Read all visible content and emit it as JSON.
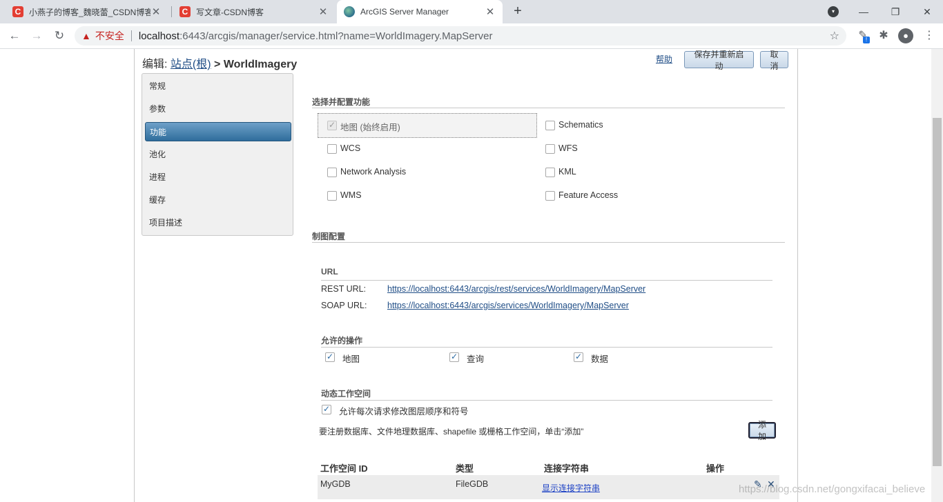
{
  "browser": {
    "tabs": [
      {
        "title": "小燕子的博客_魏晓蕾_CSDN博客",
        "favicon": "csdn-icon",
        "favicon_glyph": "C"
      },
      {
        "title": "写文章-CSDN博客",
        "favicon": "csdn-icon",
        "favicon_glyph": "C"
      },
      {
        "title": "ArcGIS Server Manager",
        "favicon": "globe-icon",
        "favicon_glyph": ""
      }
    ],
    "close_glyph": "✕",
    "new_tab_glyph": "+",
    "controls": {
      "minimize": "—",
      "restore": "❐",
      "close": "✕"
    },
    "profile_glyph": "▾",
    "nav": {
      "back": "←",
      "forward": "→",
      "reload": "↻"
    },
    "security_warning_glyph": "▲",
    "security_label": "不安全",
    "url_host": "localhost",
    "url_rest": ":6443/arcgis/manager/service.html?name=WorldImagery.MapServer",
    "bookmark_glyph": "☆",
    "extension_glyph": "✎",
    "extension_badge": "!",
    "puzzle_glyph": "✱",
    "account_glyph": "●",
    "menu_glyph": "⋮"
  },
  "page": {
    "heading_prefix": "编辑: ",
    "breadcrumb_root": "站点(根)",
    "breadcrumb_sep": " > ",
    "current_service": "WorldImagery",
    "help_label": "帮助",
    "save_restart_label": "保存并重新启动",
    "cancel_label": "取消"
  },
  "sidebar": {
    "items": [
      {
        "label": "常规"
      },
      {
        "label": "参数"
      },
      {
        "label": "功能",
        "selected": true
      },
      {
        "label": "池化"
      },
      {
        "label": "进程"
      },
      {
        "label": "缓存"
      },
      {
        "label": "项目描述"
      }
    ]
  },
  "capabilities": {
    "section_title": "选择并配置功能",
    "items": [
      {
        "label": "地图 (始终启用)",
        "checked": true,
        "disabled": true
      },
      {
        "label": "Schematics",
        "checked": false
      },
      {
        "label": "WCS",
        "checked": false
      },
      {
        "label": "WFS",
        "checked": false
      },
      {
        "label": "Network Analysis",
        "checked": false
      },
      {
        "label": "KML",
        "checked": false
      },
      {
        "label": "WMS",
        "checked": false
      },
      {
        "label": "Feature Access",
        "checked": false
      }
    ]
  },
  "mapping": {
    "section_title": "制图配置",
    "url_title": "URL",
    "rest_label": "REST URL:",
    "rest_url": "https://localhost:6443/arcgis/rest/services/WorldImagery/MapServer",
    "soap_label": "SOAP URL:",
    "soap_url": "https://localhost:6443/arcgis/services/WorldImagery/MapServer",
    "ops_title": "允许的操作",
    "operations": [
      {
        "label": "地图",
        "checked": true
      },
      {
        "label": "查询",
        "checked": true
      },
      {
        "label": "数据",
        "checked": true
      }
    ],
    "dynamic_title": "动态工作空间",
    "allow_per_request_label": "允许每次请求修改图层顺序和符号",
    "allow_per_request_checked": true,
    "register_hint": "要注册数据库、文件地理数据库、shapefile 或栅格工作空间，单击“添加”",
    "add_label": "添加",
    "table_headers": {
      "id": "工作空间 ID",
      "type": "类型",
      "connection": "连接字符串",
      "actions": "操作"
    },
    "workspaces": [
      {
        "id": "MyGDB",
        "type": "FileGDB",
        "connection_link": "显示连接字符串",
        "edit_glyph": "✎",
        "delete_glyph": "✕"
      }
    ]
  },
  "watermark": "https://blog.csdn.net/gongxifacai_believe"
}
